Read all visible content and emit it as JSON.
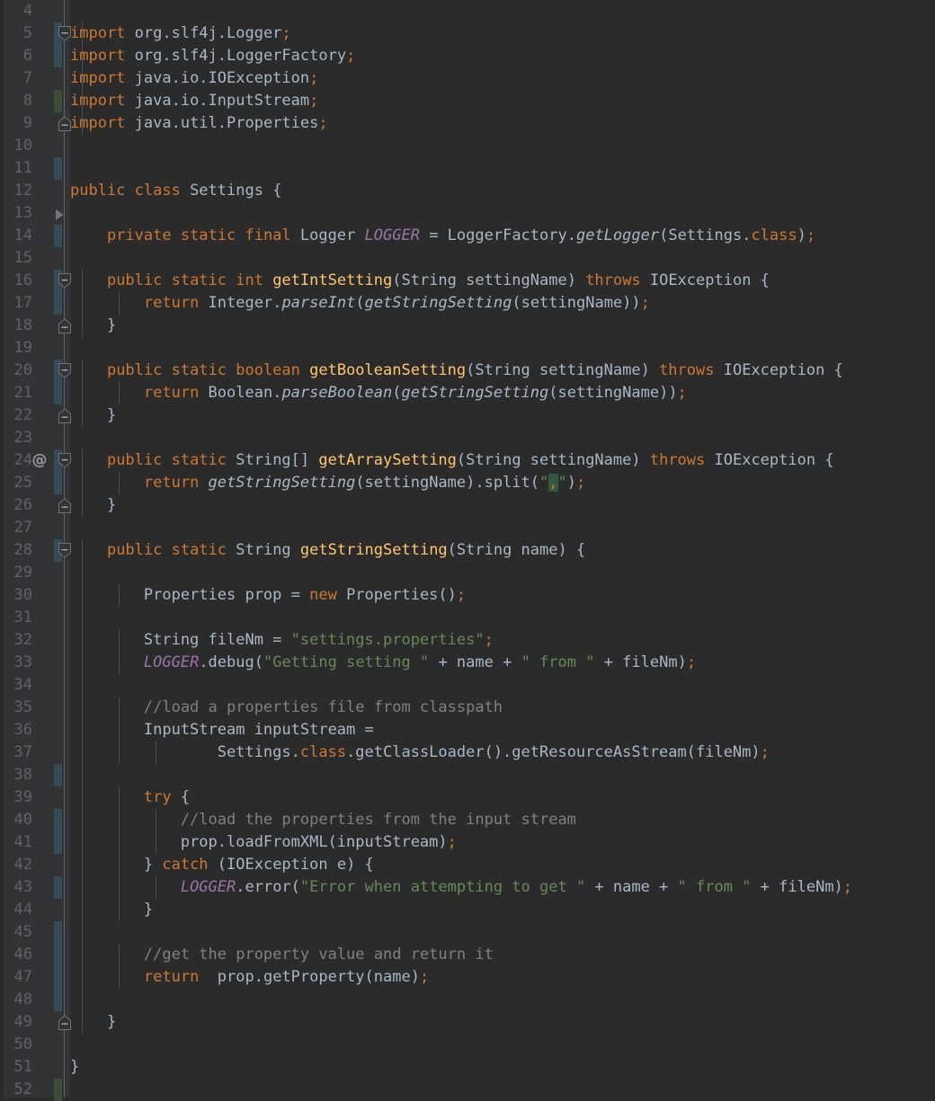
{
  "editor": {
    "language": "java",
    "theme": "darcula",
    "colors": {
      "background": "#2b2b2b",
      "gutter_background": "#313335",
      "line_number": "#606366",
      "default_text": "#a9b7c6",
      "keyword": "#cc7832",
      "string": "#6a8759",
      "comment": "#808080",
      "method_declaration": "#ffc66d",
      "static_field": "#9876aa",
      "number": "#6897bb",
      "vcs_modified": "#374b57",
      "vcs_added": "#3c4a38",
      "indent_guide": "#4b4b4b",
      "match_highlight_background": "#32593d"
    },
    "first_visible_line": 4,
    "last_visible_line": 52,
    "line_height_px": 25
  },
  "gutter": {
    "bookmark_glyph": "@",
    "bookmark_line": 24,
    "run_marker_line": 13,
    "fold_expanded_lines": [
      5,
      16,
      20,
      24,
      28
    ],
    "fold_end_lines": [
      9,
      18,
      22,
      26,
      49
    ]
  },
  "lines": [
    {
      "n": 4,
      "vcs": null,
      "fold": null,
      "indent": 0,
      "tokens": []
    },
    {
      "n": 5,
      "vcs": "blue",
      "fold": "start",
      "indent": 1,
      "tokens": [
        {
          "t": "import ",
          "c": "kw"
        },
        {
          "t": "org.slf4j.Logger",
          "c": "def"
        },
        {
          "t": ";",
          "c": "sep"
        }
      ]
    },
    {
      "n": 6,
      "vcs": "blue",
      "fold": null,
      "indent": 1,
      "tokens": [
        {
          "t": "import ",
          "c": "kw"
        },
        {
          "t": "org.slf4j.LoggerFactory",
          "c": "def"
        },
        {
          "t": ";",
          "c": "sep"
        }
      ]
    },
    {
      "n": 7,
      "vcs": null,
      "fold": null,
      "indent": 1,
      "tokens": [
        {
          "t": "import ",
          "c": "kw"
        },
        {
          "t": "java.io.IOException",
          "c": "def"
        },
        {
          "t": ";",
          "c": "sep"
        }
      ]
    },
    {
      "n": 8,
      "vcs": "green",
      "fold": null,
      "indent": 1,
      "tokens": [
        {
          "t": "import ",
          "c": "kw"
        },
        {
          "t": "java.io.InputStream",
          "c": "def"
        },
        {
          "t": ";",
          "c": "sep"
        }
      ]
    },
    {
      "n": 9,
      "vcs": null,
      "fold": "end",
      "indent": 1,
      "tokens": [
        {
          "t": "import ",
          "c": "kw"
        },
        {
          "t": "java.util.Properties",
          "c": "def"
        },
        {
          "t": ";",
          "c": "sep"
        }
      ]
    },
    {
      "n": 10,
      "vcs": null,
      "fold": null,
      "indent": 0,
      "tokens": []
    },
    {
      "n": 11,
      "vcs": "blue",
      "fold": null,
      "indent": 0,
      "tokens": []
    },
    {
      "n": 12,
      "vcs": null,
      "fold": null,
      "indent": 0,
      "tokens": [
        {
          "t": "public class ",
          "c": "kw"
        },
        {
          "t": "Settings",
          "c": "def"
        },
        {
          "t": " {",
          "c": "def"
        }
      ]
    },
    {
      "n": 13,
      "vcs": null,
      "fold": "run",
      "indent": 0,
      "tokens": []
    },
    {
      "n": 14,
      "vcs": "blue",
      "fold": null,
      "indent": 0,
      "tokens": [
        {
          "t": "    ",
          "c": "def"
        },
        {
          "t": "private static final ",
          "c": "kw"
        },
        {
          "t": "Logger ",
          "c": "def"
        },
        {
          "t": "LOGGER",
          "c": "cnst"
        },
        {
          "t": " = LoggerFactory.",
          "c": "def"
        },
        {
          "t": "getLogger",
          "c": "stat"
        },
        {
          "t": "(Settings.",
          "c": "def"
        },
        {
          "t": "class",
          "c": "kw"
        },
        {
          "t": ")",
          "c": "def"
        },
        {
          "t": ";",
          "c": "sep"
        }
      ]
    },
    {
      "n": 15,
      "vcs": null,
      "fold": null,
      "indent": 0,
      "tokens": []
    },
    {
      "n": 16,
      "vcs": "blue",
      "fold": "start",
      "indent": 1,
      "tokens": [
        {
          "t": "    ",
          "c": "def"
        },
        {
          "t": "public static int ",
          "c": "kw"
        },
        {
          "t": "getIntSetting",
          "c": "fn"
        },
        {
          "t": "(String settingName) ",
          "c": "def"
        },
        {
          "t": "throws ",
          "c": "kw"
        },
        {
          "t": "IOException {",
          "c": "def"
        }
      ]
    },
    {
      "n": 17,
      "vcs": "blue",
      "fold": null,
      "indent": 2,
      "tokens": [
        {
          "t": "        ",
          "c": "def"
        },
        {
          "t": "return ",
          "c": "kw"
        },
        {
          "t": "Integer.",
          "c": "def"
        },
        {
          "t": "parseInt",
          "c": "stat"
        },
        {
          "t": "(",
          "c": "def"
        },
        {
          "t": "getStringSetting",
          "c": "stat"
        },
        {
          "t": "(settingName))",
          "c": "def"
        },
        {
          "t": ";",
          "c": "sep"
        }
      ]
    },
    {
      "n": 18,
      "vcs": null,
      "fold": "end",
      "indent": 1,
      "tokens": [
        {
          "t": "    }",
          "c": "def"
        }
      ]
    },
    {
      "n": 19,
      "vcs": null,
      "fold": null,
      "indent": 0,
      "tokens": []
    },
    {
      "n": 20,
      "vcs": "blue",
      "fold": "start",
      "indent": 1,
      "tokens": [
        {
          "t": "    ",
          "c": "def"
        },
        {
          "t": "public static boolean ",
          "c": "kw"
        },
        {
          "t": "getBooleanSetting",
          "c": "fn"
        },
        {
          "t": "(String settingName) ",
          "c": "def"
        },
        {
          "t": "throws ",
          "c": "kw"
        },
        {
          "t": "IOException {",
          "c": "def"
        }
      ]
    },
    {
      "n": 21,
      "vcs": "blue",
      "fold": null,
      "indent": 2,
      "tokens": [
        {
          "t": "        ",
          "c": "def"
        },
        {
          "t": "return ",
          "c": "kw"
        },
        {
          "t": "Boolean.",
          "c": "def"
        },
        {
          "t": "parseBoolean",
          "c": "stat"
        },
        {
          "t": "(",
          "c": "def"
        },
        {
          "t": "getStringSetting",
          "c": "stat"
        },
        {
          "t": "(settingName))",
          "c": "def"
        },
        {
          "t": ";",
          "c": "sep"
        }
      ]
    },
    {
      "n": 22,
      "vcs": null,
      "fold": "end",
      "indent": 1,
      "tokens": [
        {
          "t": "    }",
          "c": "def"
        }
      ]
    },
    {
      "n": 23,
      "vcs": null,
      "fold": null,
      "indent": 0,
      "tokens": []
    },
    {
      "n": 24,
      "vcs": "blue",
      "fold": "start",
      "indent": 1,
      "bookmark": "@",
      "tokens": [
        {
          "t": "    ",
          "c": "def"
        },
        {
          "t": "public static ",
          "c": "kw"
        },
        {
          "t": "String[] ",
          "c": "def"
        },
        {
          "t": "getArraySetting",
          "c": "fn"
        },
        {
          "t": "(String settingName) ",
          "c": "def"
        },
        {
          "t": "throws ",
          "c": "kw"
        },
        {
          "t": "IOException {",
          "c": "def"
        }
      ]
    },
    {
      "n": 25,
      "vcs": "blue",
      "fold": null,
      "indent": 2,
      "tokens": [
        {
          "t": "        ",
          "c": "def"
        },
        {
          "t": "return ",
          "c": "kw"
        },
        {
          "t": "getStringSetting",
          "c": "stat"
        },
        {
          "t": "(settingName).split(",
          "c": "def"
        },
        {
          "t": "\"",
          "c": "str"
        },
        {
          "t": ",",
          "c": "hl"
        },
        {
          "t": "\"",
          "c": "str"
        },
        {
          "t": ")",
          "c": "def"
        },
        {
          "t": ";",
          "c": "sep"
        }
      ]
    },
    {
      "n": 26,
      "vcs": null,
      "fold": "end",
      "indent": 1,
      "tokens": [
        {
          "t": "    }",
          "c": "def"
        }
      ]
    },
    {
      "n": 27,
      "vcs": null,
      "fold": null,
      "indent": 0,
      "tokens": []
    },
    {
      "n": 28,
      "vcs": "blue",
      "fold": "start",
      "indent": 1,
      "tokens": [
        {
          "t": "    ",
          "c": "def"
        },
        {
          "t": "public static ",
          "c": "kw"
        },
        {
          "t": "String ",
          "c": "def"
        },
        {
          "t": "getStringSetting",
          "c": "fn"
        },
        {
          "t": "(String name) {",
          "c": "def"
        }
      ]
    },
    {
      "n": 29,
      "vcs": null,
      "fold": null,
      "indent": 1,
      "tokens": []
    },
    {
      "n": 30,
      "vcs": null,
      "fold": null,
      "indent": 2,
      "tokens": [
        {
          "t": "        Properties prop = ",
          "c": "def"
        },
        {
          "t": "new ",
          "c": "kw"
        },
        {
          "t": "Properties()",
          "c": "def"
        },
        {
          "t": ";",
          "c": "sep"
        }
      ]
    },
    {
      "n": 31,
      "vcs": null,
      "fold": null,
      "indent": 1,
      "tokens": []
    },
    {
      "n": 32,
      "vcs": null,
      "fold": null,
      "indent": 2,
      "tokens": [
        {
          "t": "        String fileNm = ",
          "c": "def"
        },
        {
          "t": "\"settings.properties\"",
          "c": "str"
        },
        {
          "t": ";",
          "c": "sep"
        }
      ]
    },
    {
      "n": 33,
      "vcs": null,
      "fold": null,
      "indent": 2,
      "tokens": [
        {
          "t": "        ",
          "c": "def"
        },
        {
          "t": "LOGGER",
          "c": "cnst"
        },
        {
          "t": ".debug(",
          "c": "def"
        },
        {
          "t": "\"Getting setting \"",
          "c": "str"
        },
        {
          "t": " + name + ",
          "c": "def"
        },
        {
          "t": "\" from \"",
          "c": "str"
        },
        {
          "t": " + fileNm)",
          "c": "def"
        },
        {
          "t": ";",
          "c": "sep"
        }
      ]
    },
    {
      "n": 34,
      "vcs": null,
      "fold": null,
      "indent": 1,
      "tokens": []
    },
    {
      "n": 35,
      "vcs": null,
      "fold": null,
      "indent": 2,
      "tokens": [
        {
          "t": "        //load a properties file from classpath",
          "c": "cmt"
        }
      ]
    },
    {
      "n": 36,
      "vcs": null,
      "fold": null,
      "indent": 2,
      "tokens": [
        {
          "t": "        InputStream inputStream =",
          "c": "def"
        }
      ]
    },
    {
      "n": 37,
      "vcs": null,
      "fold": null,
      "indent": 3,
      "tokens": [
        {
          "t": "                Settings.",
          "c": "def"
        },
        {
          "t": "class",
          "c": "kw"
        },
        {
          "t": ".getClassLoader().getResourceAsStream(fileNm)",
          "c": "def"
        },
        {
          "t": ";",
          "c": "sep"
        }
      ]
    },
    {
      "n": 38,
      "vcs": "blue",
      "fold": null,
      "indent": 1,
      "tokens": []
    },
    {
      "n": 39,
      "vcs": null,
      "fold": null,
      "indent": 2,
      "tokens": [
        {
          "t": "        ",
          "c": "def"
        },
        {
          "t": "try ",
          "c": "kw"
        },
        {
          "t": "{",
          "c": "def"
        }
      ]
    },
    {
      "n": 40,
      "vcs": "blue",
      "fold": null,
      "indent": 3,
      "tokens": [
        {
          "t": "            //load the properties from the input stream",
          "c": "cmt"
        }
      ]
    },
    {
      "n": 41,
      "vcs": "blue",
      "fold": null,
      "indent": 3,
      "tokens": [
        {
          "t": "            prop.loadFromXML(inputStream)",
          "c": "def"
        },
        {
          "t": ";",
          "c": "sep"
        }
      ]
    },
    {
      "n": 42,
      "vcs": null,
      "fold": null,
      "indent": 2,
      "tokens": [
        {
          "t": "        } ",
          "c": "def"
        },
        {
          "t": "catch ",
          "c": "kw"
        },
        {
          "t": "(IOException e) {",
          "c": "def"
        }
      ]
    },
    {
      "n": 43,
      "vcs": "blue",
      "fold": null,
      "indent": 3,
      "tokens": [
        {
          "t": "            ",
          "c": "def"
        },
        {
          "t": "LOGGER",
          "c": "cnst"
        },
        {
          "t": ".error(",
          "c": "def"
        },
        {
          "t": "\"Error when attempting to get \"",
          "c": "str"
        },
        {
          "t": " + name + ",
          "c": "def"
        },
        {
          "t": "\" from \"",
          "c": "str"
        },
        {
          "t": " + fileNm)",
          "c": "def"
        },
        {
          "t": ";",
          "c": "sep"
        }
      ]
    },
    {
      "n": 44,
      "vcs": null,
      "fold": null,
      "indent": 2,
      "tokens": [
        {
          "t": "        }",
          "c": "def"
        }
      ]
    },
    {
      "n": 45,
      "vcs": "blue",
      "fold": null,
      "indent": 1,
      "tokens": []
    },
    {
      "n": 46,
      "vcs": "blue",
      "fold": null,
      "indent": 2,
      "tokens": [
        {
          "t": "        //get the property value and return it",
          "c": "cmt"
        }
      ]
    },
    {
      "n": 47,
      "vcs": "blue",
      "fold": null,
      "indent": 2,
      "tokens": [
        {
          "t": "        ",
          "c": "def"
        },
        {
          "t": "return ",
          "c": "kw"
        },
        {
          "t": " prop.getProperty(name)",
          "c": "def"
        },
        {
          "t": ";",
          "c": "sep"
        }
      ]
    },
    {
      "n": 48,
      "vcs": "blue",
      "fold": null,
      "indent": 1,
      "tokens": []
    },
    {
      "n": 49,
      "vcs": null,
      "fold": "end",
      "indent": 1,
      "tokens": [
        {
          "t": "    }",
          "c": "def"
        }
      ]
    },
    {
      "n": 50,
      "vcs": null,
      "fold": null,
      "indent": 0,
      "tokens": []
    },
    {
      "n": 51,
      "vcs": null,
      "fold": null,
      "indent": 0,
      "tokens": [
        {
          "t": "}",
          "c": "def"
        }
      ]
    },
    {
      "n": 52,
      "vcs": "green",
      "fold": null,
      "indent": 0,
      "tokens": []
    }
  ]
}
